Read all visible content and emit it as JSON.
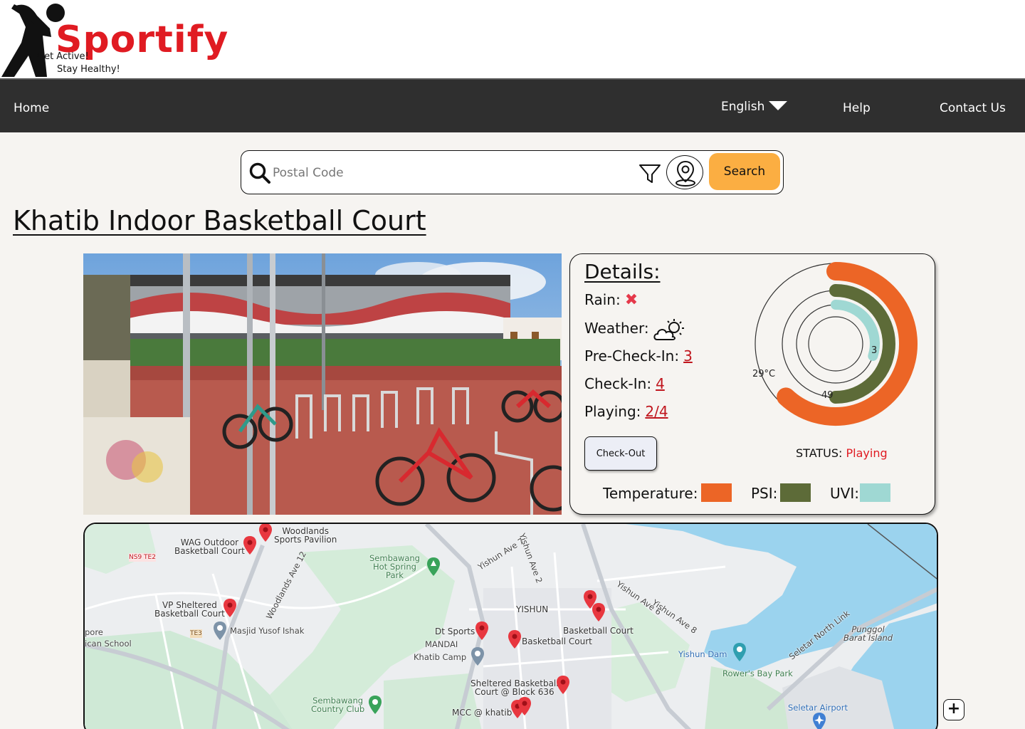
{
  "brand": {
    "name": "Sportify",
    "tagline_1": "Get Active!",
    "tagline_2": "Stay Healthy!"
  },
  "nav": {
    "home": "Home",
    "language": "English",
    "help": "Help",
    "contact": "Contact Us"
  },
  "search": {
    "placeholder": "Postal Code",
    "button": "Search"
  },
  "page": {
    "title": "Khatib Indoor Basketball Court"
  },
  "details": {
    "heading": "Details:",
    "rain_label": "Rain:",
    "rain_value": "✖",
    "weather_label": "Weather:",
    "weather_icon": "partly-cloudy-icon",
    "precheckin_label": "Pre-Check-In:",
    "precheckin_value": "3",
    "checkin_label": "Check-In:",
    "checkin_value": "4",
    "playing_label": "Playing:",
    "playing_value": "2/4",
    "checkout_button": "Check-Out",
    "status_label": "STATUS:",
    "status_value": "Playing",
    "legend": {
      "temperature": "Temperature:",
      "psi": "PSI:",
      "uvi": "UVI:"
    },
    "gauge": {
      "temperature_label": "29°C",
      "psi_label": "49",
      "uvi_label": "3",
      "temperature_fraction": 0.62,
      "psi_fraction": 0.5,
      "uvi_fraction": 0.3
    },
    "colors": {
      "temperature": "#ec6526",
      "psi": "#5d6b38",
      "uvi": "#9fd8d3",
      "status": "#e01b22",
      "link": "#c0161e"
    }
  },
  "map": {
    "labels": {
      "woodlands_pavilion": "Woodlands\nSports Pavilion",
      "wag_court": "WAG Outdoor\nBasketball Court",
      "sembawang_hot_spring": "Sembawang\nHot Spring\nPark",
      "yishun": "YISHUN",
      "vp_court": "VP Sheltered\nBasketball Court",
      "masjid": "Masjid Yusof Ishak",
      "dt_sports": "Dt Sports",
      "basketball_court_1": "Basketball Court",
      "basketball_court_2": "Basketball Court",
      "mandai": "MANDAI",
      "khatib_camp": "Khatib Camp",
      "sheltered_court_636": "Sheltered Basketball\nCourt @ Block 636",
      "sembawang_cc": "Sembawang\nCountry Club",
      "mcc_khatib": "MCC @ khatib",
      "yishun_dam": "Yishun Dam",
      "rowers_bay": "Rower's Bay Park",
      "punggol_barat": "Punggol\nBarat Island",
      "seletar_airport": "Seletar Airport",
      "pore": "pore",
      "school": "ican School",
      "yishun_ave_7": "Yishun Ave 7",
      "yishun_ave_2": "Yishun Ave 2",
      "yishun_ave_6": "Yishun Ave 6",
      "yishun_ave_8": "Yishun Ave 8",
      "woodlands_ave_12": "Woodlands Ave 12",
      "seletar_north_link": "Seletar North Link",
      "ns9": "NS9 TE2",
      "te3": "TE3"
    },
    "zoom_in": "+"
  }
}
